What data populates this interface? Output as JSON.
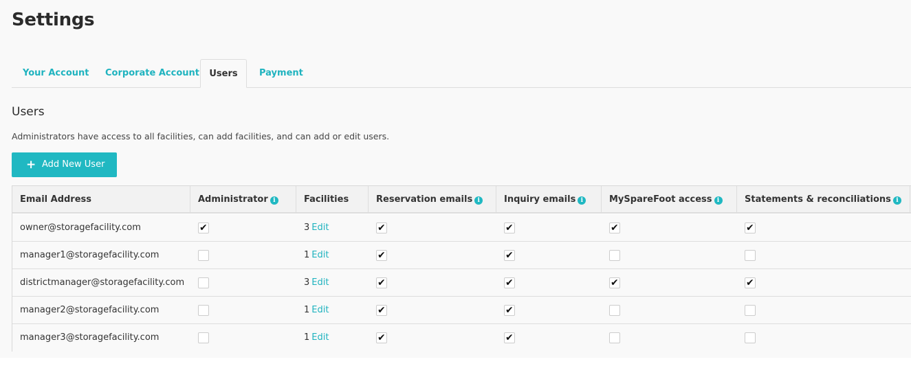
{
  "page": {
    "title": "Settings"
  },
  "tabs": [
    {
      "label": "Your Account",
      "active": false
    },
    {
      "label": "Corporate Account",
      "active": false
    },
    {
      "label": "Users",
      "active": true
    },
    {
      "label": "Payment",
      "active": false
    }
  ],
  "users_section": {
    "title": "Users",
    "description": "Administrators have access to all facilities, can add facilities, and can add or edit users.",
    "add_button_label": "Add New User",
    "add_button_icon": "plus-icon"
  },
  "table": {
    "headers": {
      "email": "Email Address",
      "administrator": "Administrator",
      "facilities": "Facilities",
      "reservation_emails": "Reservation emails",
      "inquiry_emails": "Inquiry emails",
      "myssparefoot_access": "MySpareFoot access",
      "statements": "Statements & reconciliations"
    },
    "info_icon_glyph": "i",
    "edit_label": "Edit",
    "rows": [
      {
        "email": "owner@storagefacility.com",
        "administrator": true,
        "facilities": "3",
        "reservation_emails": true,
        "inquiry_emails": true,
        "myssparefoot_access": true,
        "statements": true
      },
      {
        "email": "manager1@storagefacility.com",
        "administrator": false,
        "facilities": "1",
        "reservation_emails": true,
        "inquiry_emails": true,
        "myssparefoot_access": false,
        "statements": false
      },
      {
        "email": "districtmanager@storagefacility.com",
        "administrator": false,
        "facilities": "3",
        "reservation_emails": true,
        "inquiry_emails": true,
        "myssparefoot_access": true,
        "statements": true
      },
      {
        "email": "manager2@storagefacility.com",
        "administrator": false,
        "facilities": "1",
        "reservation_emails": true,
        "inquiry_emails": true,
        "myssparefoot_access": false,
        "statements": false
      },
      {
        "email": "manager3@storagefacility.com",
        "administrator": false,
        "facilities": "1",
        "reservation_emails": true,
        "inquiry_emails": true,
        "myssparefoot_access": false,
        "statements": false
      }
    ]
  },
  "colors": {
    "accent": "#20b8c2",
    "link": "#1fb3bf",
    "background": "#f9f9f9"
  }
}
